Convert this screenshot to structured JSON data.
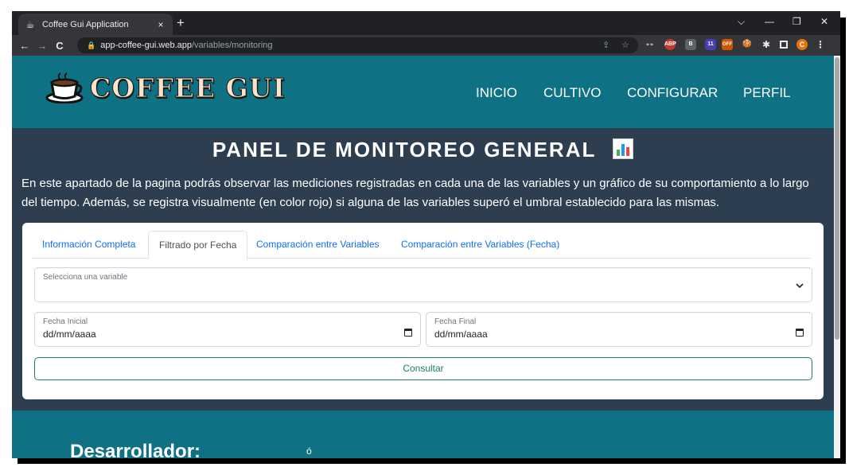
{
  "browser": {
    "tab_title": "Coffee Gui Application",
    "tab_close": "×",
    "new_tab": "+",
    "url_host": "app-coffee-gui.web.app",
    "url_path": "/variables/monitoring",
    "minimize": "—",
    "maximize": "❐",
    "close": "✕",
    "dropdown": "⌵",
    "back": "←",
    "forward": "→",
    "reload": "C",
    "extensions": [
      {
        "name": "ext-1",
        "label": "👓",
        "color": "#35363a"
      },
      {
        "name": "abp",
        "label": "ABP",
        "color": "#c0392b"
      },
      {
        "name": "ext-3",
        "label": "B",
        "color": "#5f6368"
      },
      {
        "name": "ext-4",
        "label": "11",
        "color": "#4a3cb5"
      },
      {
        "name": "ext-5",
        "label": "OFF",
        "color": "#d35400"
      },
      {
        "name": "ext-6",
        "label": "🍪",
        "color": "#35363a"
      }
    ],
    "profile_initial": "C"
  },
  "navbar": {
    "brand": "COFFEE GUI",
    "links": [
      "INICIO",
      "CULTIVO",
      "CONFIGURAR",
      "PERFIL"
    ]
  },
  "main": {
    "heading": "PANEL DE MONITOREO GENERAL",
    "intro": "En este apartado de la pagina podrás observar las mediciones registradas en cada una de las variables y un gráfico de su comportamiento a lo largo del tiempo. Además, se registra visualmente (en color rojo) si alguna de las variables superó el umbral establecido para las mismas."
  },
  "card": {
    "tabs": [
      {
        "label": "Información Completa",
        "active": false
      },
      {
        "label": "Filtrado por Fecha",
        "active": true
      },
      {
        "label": "Comparación entre Variables",
        "active": false
      },
      {
        "label": "Comparación entre Variables (Fecha)",
        "active": false
      }
    ],
    "variable_select_label": "Selecciona una variable",
    "variable_select_value": "",
    "start_date_label": "Fecha Inicial",
    "start_date_value": "dd/mm/aaaa",
    "end_date_label": "Fecha Final",
    "end_date_value": "dd/mm/aaaa",
    "submit_label": "Consultar"
  },
  "footer": {
    "developer_heading": "Desarrollador:",
    "partial_text": "ó"
  },
  "colors": {
    "navbar_bg": "#0f7184",
    "page_bg": "#2c3e50",
    "link_blue": "#0d6efd",
    "button_green": "#198754",
    "brand_text": "#fbe3cc"
  }
}
